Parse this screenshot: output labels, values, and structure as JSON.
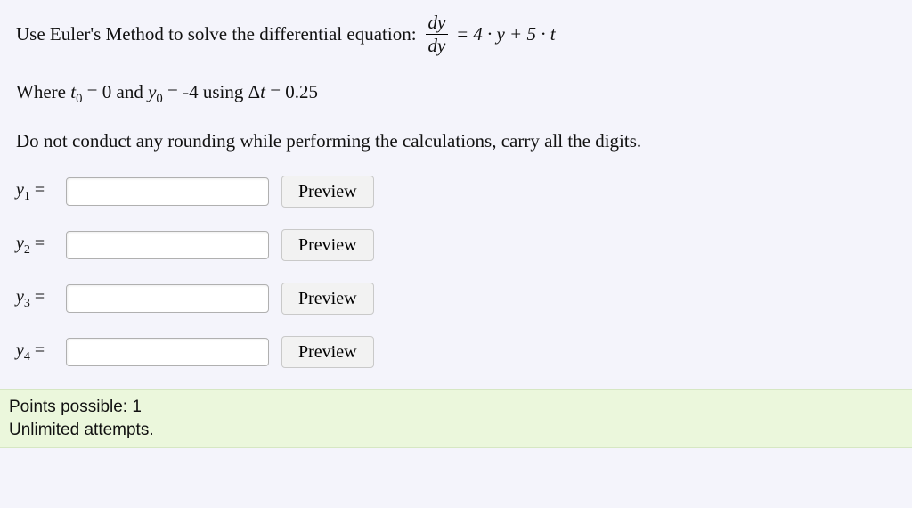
{
  "problem": {
    "prompt_lead": "Use Euler's Method to solve the differential equation:",
    "equation": {
      "frac_num": "dy",
      "frac_den": "dy",
      "eq_sign": "=",
      "rhs": "4 · y + 5 · t"
    },
    "conditions_text_a": "Where ",
    "t_label": "t",
    "t_sub": "0",
    "cond_mid1": " = 0 and ",
    "y_label": "y",
    "y_sub": "0",
    "cond_mid2": " = -4 using Δ",
    "delta_var": "t",
    "cond_tail": " = 0.25",
    "instructions": "Do not conduct any rounding while performing the calculations, carry all the digits.",
    "answers": [
      {
        "label_var": "y",
        "label_sub": "1",
        "equals": " = ",
        "value": "",
        "preview": "Preview"
      },
      {
        "label_var": "y",
        "label_sub": "2",
        "equals": " = ",
        "value": "",
        "preview": "Preview"
      },
      {
        "label_var": "y",
        "label_sub": "3",
        "equals": " = ",
        "value": "",
        "preview": "Preview"
      },
      {
        "label_var": "y",
        "label_sub": "4",
        "equals": " = ",
        "value": "",
        "preview": "Preview"
      }
    ]
  },
  "footer": {
    "points": "Points possible: 1",
    "attempts": "Unlimited attempts."
  }
}
